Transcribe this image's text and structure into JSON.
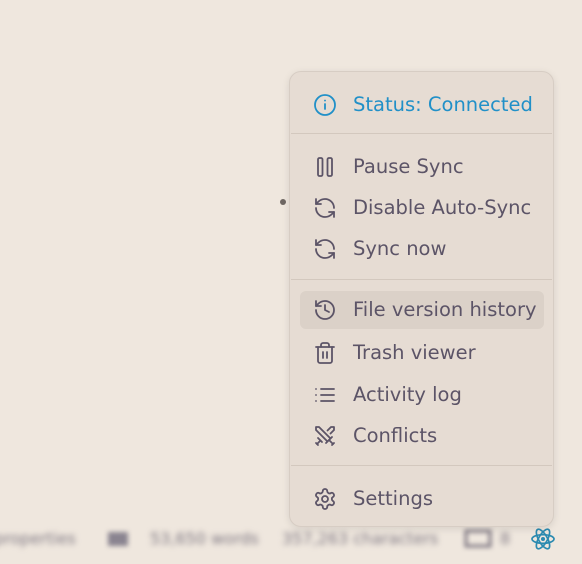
{
  "menu": {
    "status": {
      "label": "Status: Connected",
      "icon": "info-icon"
    },
    "items": [
      {
        "label": "Pause Sync",
        "icon": "pause-icon"
      },
      {
        "label": "Disable Auto-Sync",
        "icon": "sync-toggle-icon"
      },
      {
        "label": "Sync now",
        "icon": "refresh-icon"
      },
      {
        "label": "File version history",
        "icon": "history-icon"
      },
      {
        "label": "Trash viewer",
        "icon": "trash-icon"
      },
      {
        "label": "Activity log",
        "icon": "list-icon"
      },
      {
        "label": "Conflicts",
        "icon": "swords-icon"
      },
      {
        "label": "Settings",
        "icon": "gear-icon"
      }
    ]
  },
  "status_bar": {
    "properties_label": "properties",
    "words_label": "53,650 words",
    "characters_label": "357,263 characters",
    "count_label": "8"
  },
  "colors": {
    "accent": "#2190c8",
    "menu_text": "#5c5467",
    "menu_bg": "#e6dcd3",
    "page_bg": "#efe7de",
    "react_icon": "#2b8ab0"
  }
}
